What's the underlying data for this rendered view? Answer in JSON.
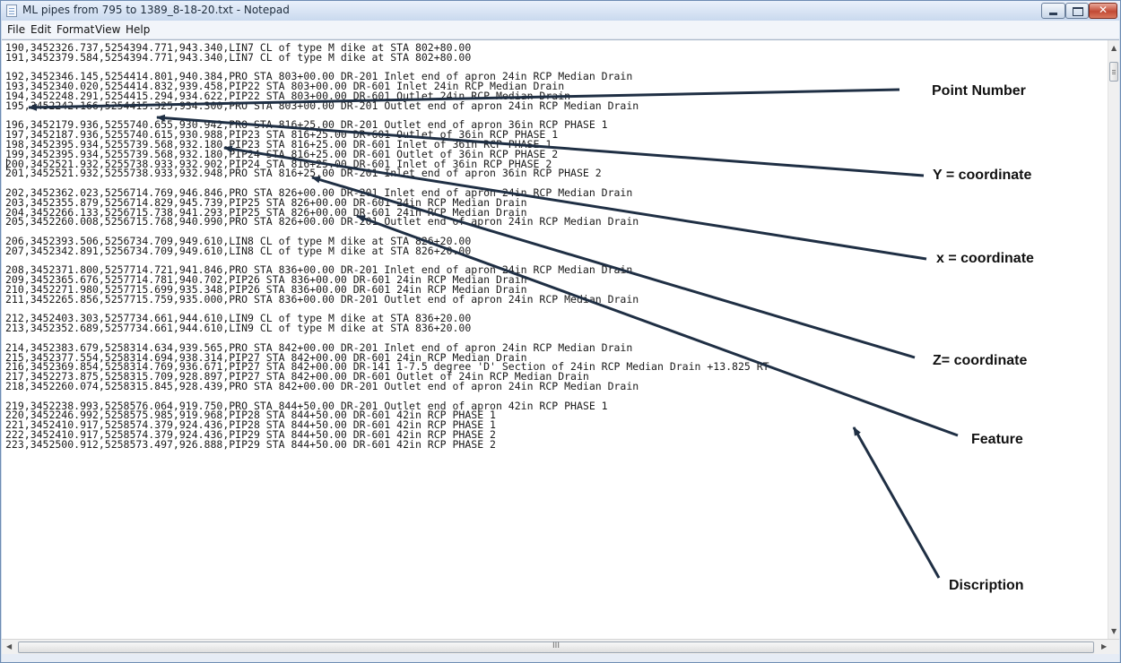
{
  "window": {
    "title": "ML pipes from 795 to 1389_8-18-20.txt - Notepad",
    "controls": [
      "minimize",
      "maximize",
      "close"
    ]
  },
  "menu": [
    "File",
    "Edit",
    "Format",
    "View",
    "Help"
  ],
  "lines": [
    "190,3452326.737,5254394.771,943.340,LIN7 CL of type M dike at STA 802+80.00",
    "191,3452379.584,5254394.771,943.340,LIN7 CL of type M dike at STA 802+80.00",
    "",
    "192,3452346.145,5254414.801,940.384,PRO STA 803+00.00 DR-201 Inlet end of apron 24in RCP Median Drain",
    "193,3452340.020,5254414.832,939.458,PIP22 STA 803+00.00 DR-601 Inlet 24in RCP Median Drain",
    "194,3452248.291,5254415.294,934.622,PIP22 STA 803+00.00 DR-601 Outlet 24in RCP Median Drain",
    "195,3452242.166,5254415.325,934.300,PRO STA 803+00.00 DR-201 Outlet end of apron 24in RCP Median Drain",
    "",
    "196,3452179.936,5255740.655,930.942,PRO STA 816+25.00 DR-201 Outlet end of apron 36in RCP PHASE 1",
    "197,3452187.936,5255740.615,930.988,PIP23 STA 816+25.00 DR-601 Outlet of 36in RCP PHASE 1",
    "198,3452395.934,5255739.568,932.180,PIP23 STA 816+25.00 DR-601 Inlet of 36in RCP PHASE 1",
    "199,3452395.934,5255739.568,932.180,PIP24 STA 816+25.00 DR-601 Outlet of 36in RCP PHASE 2",
    "200,3452521.932,5255738.933,932.902,PIP24 STA 816+25.00 DR-601 Inlet of 36in RCP PHASE 2",
    "201,3452521.932,5255738.933,932.948,PRO STA 816+25.00 DR-201 Inlet end of apron 36in RCP PHASE 2",
    "",
    "202,3452362.023,5256714.769,946.846,PRO STA 826+00.00 DR-201 Inlet end of apron 24in RCP Median Drain",
    "203,3452355.879,5256714.829,945.739,PIP25 STA 826+00.00 DR-601 24in RCP Median Drain",
    "204,3452266.133,5256715.738,941.293,PIP25 STA 826+00.00 DR-601 24in RCP Median Drain",
    "205,3452260.008,5256715.768,940.990,PRO STA 826+00.00 DR-201 Outlet end of apron 24in RCP Median Drain",
    "",
    "206,3452393.506,5256734.709,949.610,LIN8 CL of type M dike at STA 826+20.00",
    "207,3452342.891,5256734.709,949.610,LIN8 CL of type M dike at STA 826+20.00",
    "",
    "208,3452371.800,5257714.721,941.846,PRO STA 836+00.00 DR-201 Inlet end of apron 24in RCP Median Drain",
    "209,3452365.676,5257714.781,940.702,PIP26 STA 836+00.00 DR-601 24in RCP Median Drain",
    "210,3452271.980,5257715.699,935.348,PIP26 STA 836+00.00 DR-601 24in RCP Median Drain",
    "211,3452265.856,5257715.759,935.000,PRO STA 836+00.00 DR-201 Outlet end of apron 24in RCP Median Drain",
    "",
    "212,3452403.303,5257734.661,944.610,LIN9 CL of type M dike at STA 836+20.00",
    "213,3452352.689,5257734.661,944.610,LIN9 CL of type M dike at STA 836+20.00",
    "",
    "214,3452383.679,5258314.634,939.565,PRO STA 842+00.00 DR-201 Inlet end of apron 24in RCP Median Drain",
    "215,3452377.554,5258314.694,938.314,PIP27 STA 842+00.00 DR-601 24in RCP Median Drain",
    "216,3452369.854,5258314.769,936.671,PIP27 STA 842+00.00 DR-141 1-7.5 degree 'D' Section of 24in RCP Median Drain +13.825 RT",
    "217,3452273.875,5258315.709,928.897,PIP27 STA 842+00.00 DR-601 Outlet of 24in RCP Median Drain",
    "218,3452260.074,5258315.845,928.439,PRO STA 842+00.00 DR-201 Outlet end of apron 24in RCP Median Drain",
    "",
    "219,3452238.993,5258576.064,919.750,PRO STA 844+50.00 DR-201 Outlet end of apron 42in RCP PHASE 1",
    "220,3452246.992,5258575.985,919.968,PIP28 STA 844+50.00 DR-601 42in RCP PHASE 1",
    "221,3452410.917,5258574.379,924.436,PIP28 STA 844+50.00 DR-601 42in RCP PHASE 1",
    "222,3452410.917,5258574.379,924.436,PIP29 STA 844+50.00 DR-601 42in RCP PHASE 2",
    "223,3452500.912,5258573.497,926.888,PIP29 STA 844+50.00 DR-601 42in RCP PHASE 2"
  ],
  "annotations": {
    "point_number": "Point Number",
    "y_coordinate": "Y = coordinate",
    "x_coordinate": "x = coordinate",
    "z_coordinate": "Z= coordinate",
    "feature": "Feature",
    "description": "Discription"
  },
  "scrollbar": {
    "grip": "III"
  }
}
